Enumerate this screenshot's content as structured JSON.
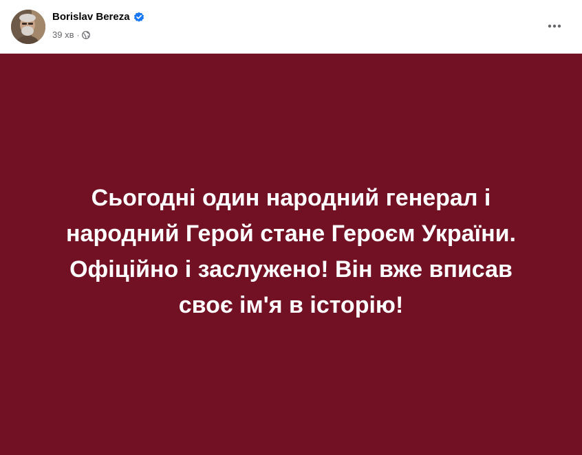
{
  "post": {
    "author_name": "Borislav Bereza",
    "verified": true,
    "timestamp": "39 хв",
    "separator": "·",
    "privacy_icon": "globe-icon",
    "more_icon": "more-options-icon",
    "background_color": "#721124",
    "text_color": "#ffffff",
    "text": "Сьогодні один народний генерал і\nнародний Герой стане Героєм України.\nОфіційно і заслужено! Він вже вписав\nсвоє ім'я в історію!"
  },
  "colors": {
    "verified_badge": "#1877f2",
    "meta_text": "#65676b",
    "name_text": "#050505"
  }
}
